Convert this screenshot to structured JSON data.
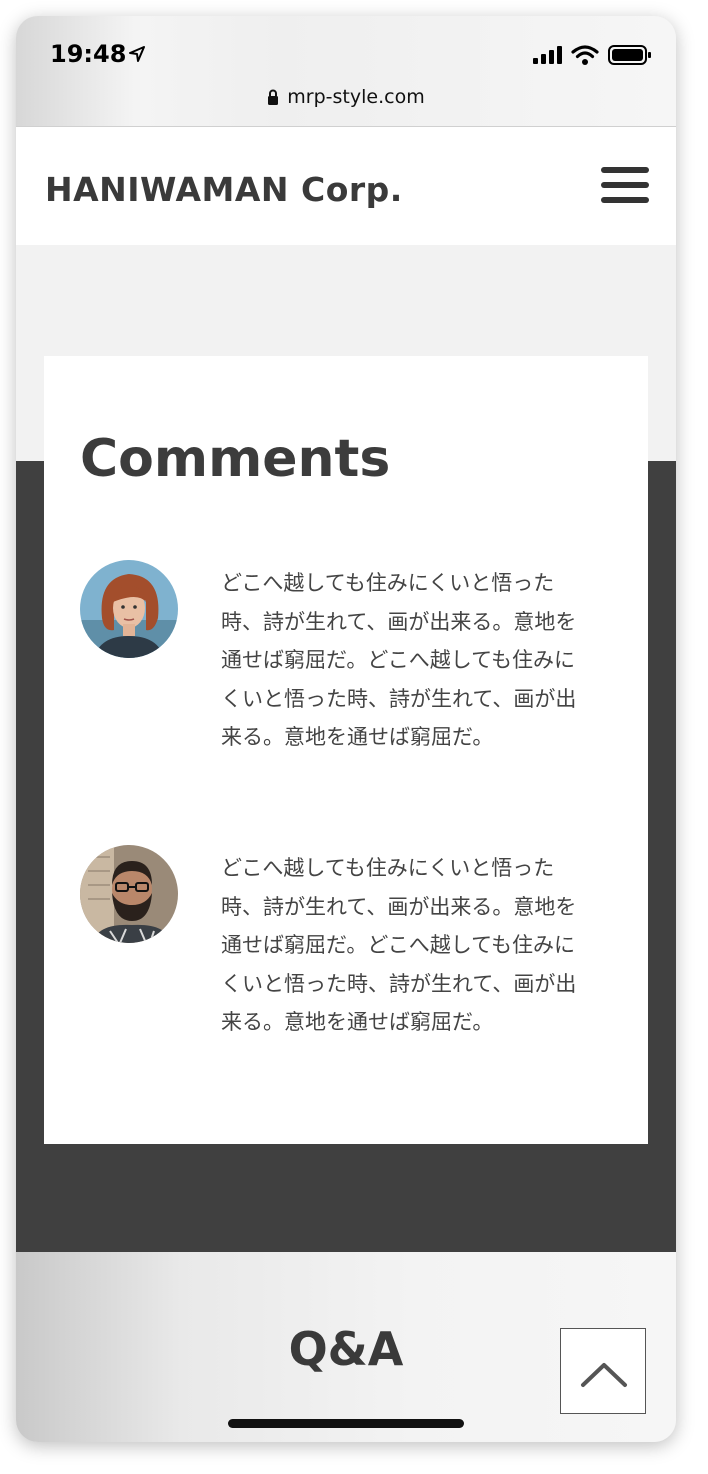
{
  "status_bar": {
    "time": "19:48",
    "url": "mrp-style.com",
    "icons": [
      "location-arrow-icon",
      "signal-icon",
      "wifi-icon",
      "battery-icon",
      "lock-icon"
    ]
  },
  "header": {
    "logo_text": "HANIWAMAN Corp.",
    "menu_icon": "hamburger-menu-icon"
  },
  "comments_section": {
    "title": "Comments",
    "items": [
      {
        "avatar": "avatar-woman",
        "text": "どこへ越しても住みにくいと悟った時、詩が生れて、画が出来る。意地を通せば窮屈だ。どこへ越しても住みにくいと悟った時、詩が生れて、画が出来る。意地を通せば窮屈だ。"
      },
      {
        "avatar": "avatar-man",
        "text": "どこへ越しても住みにくいと悟った時、詩が生れて、画が出来る。意地を通せば窮屈だ。どこへ越しても住みにくいと悟った時、詩が生れて、画が出来る。意地を通せば窮屈だ。"
      }
    ]
  },
  "qa_section": {
    "title": "Q&A"
  },
  "scroll_top_button": {
    "icon": "chevron-up-icon"
  },
  "colors": {
    "dark_band": "#404040",
    "card": "#ffffff",
    "text": "#444444",
    "page_bg": "#f2f2f2"
  }
}
